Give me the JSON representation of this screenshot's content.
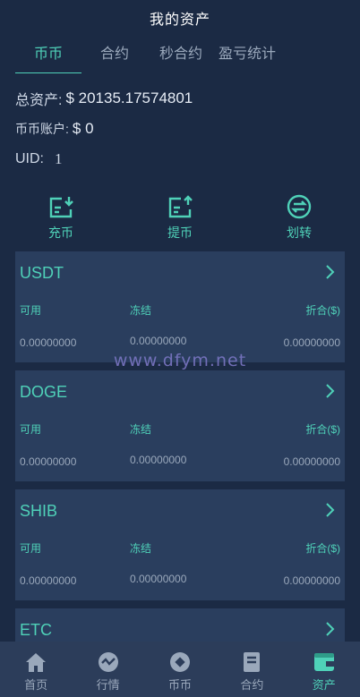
{
  "header": {
    "title": "我的资产"
  },
  "tabs": [
    {
      "label": "币币",
      "active": true
    },
    {
      "label": "合约",
      "active": false
    },
    {
      "label": "秒合约",
      "active": false
    },
    {
      "label": "盈亏统计",
      "active": false
    }
  ],
  "summary": {
    "total_label": "总资产:",
    "total_value": "$ 20135.17574801",
    "account_label": "币币账户:",
    "account_value": "$ 0",
    "uid_label": "UID:",
    "uid_value": "1"
  },
  "actions": [
    {
      "label": "充币",
      "icon": "deposit-icon"
    },
    {
      "label": "提币",
      "icon": "withdraw-icon"
    },
    {
      "label": "划转",
      "icon": "transfer-icon"
    }
  ],
  "columns": {
    "available": "可用",
    "frozen": "冻结",
    "converted": "折合($)"
  },
  "coins": [
    {
      "name": "USDT",
      "available": "0.00000000",
      "frozen": "0.00000000",
      "converted": "0.00000000"
    },
    {
      "name": "DOGE",
      "available": "0.00000000",
      "frozen": "0.00000000",
      "converted": "0.00000000"
    },
    {
      "name": "SHIB",
      "available": "0.00000000",
      "frozen": "0.00000000",
      "converted": "0.00000000"
    },
    {
      "name": "ETC"
    }
  ],
  "watermark": "www.dfym.net",
  "nav": [
    {
      "label": "首页",
      "icon": "home-icon",
      "active": false
    },
    {
      "label": "行情",
      "icon": "market-icon",
      "active": false
    },
    {
      "label": "币币",
      "icon": "coin-icon",
      "active": false
    },
    {
      "label": "合约",
      "icon": "contract-icon",
      "active": false
    },
    {
      "label": "资产",
      "icon": "wallet-icon",
      "active": true
    }
  ],
  "colors": {
    "accent": "#4fd1b8",
    "background": "#1b2a44",
    "card": "#2a3e5e",
    "nav": "#2c3d5a"
  }
}
